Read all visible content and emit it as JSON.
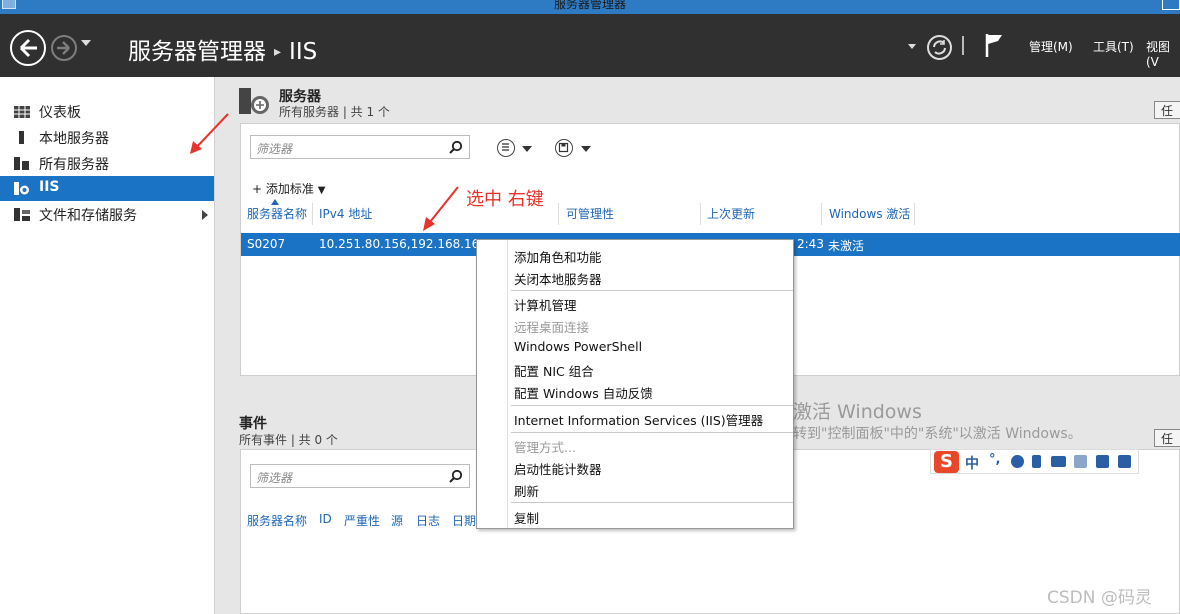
{
  "window": {
    "title": "服务器管理器"
  },
  "header": {
    "breadcrumb": [
      "服务器管理器",
      "IIS"
    ],
    "menus": [
      "管理(M)",
      "工具(T)",
      "视图(V"
    ]
  },
  "sidebar": {
    "items": [
      {
        "label": "仪表板",
        "icon": "dashboard-icon"
      },
      {
        "label": "本地服务器",
        "icon": "server-icon"
      },
      {
        "label": "所有服务器",
        "icon": "servers-icon"
      },
      {
        "label": "IIS",
        "icon": "iis-icon",
        "active": true
      },
      {
        "label": "文件和存储服务",
        "icon": "storage-icon",
        "has_submenu": true
      }
    ]
  },
  "servers_panel": {
    "title": "服务器",
    "subtitle": "所有服务器 | 共 1 个",
    "task_button": "任务",
    "filter_placeholder": "筛选器",
    "add_criteria": "添加标准",
    "columns": [
      "服务器名称",
      "IPv4 地址",
      "可管理性",
      "上次更新",
      "Windows 激活"
    ],
    "row": {
      "name": "S0207",
      "ipv4": "10.251.80.156,192.168.164.1",
      "last_update_tail": "2:43",
      "activation": "未激活"
    }
  },
  "events_panel": {
    "title": "事件",
    "subtitle": "所有事件 | 共 0 个",
    "task_button": "任务",
    "filter_placeholder": "筛选器",
    "columns": [
      "服务器名称",
      "ID",
      "严重性",
      "源",
      "日志",
      "日期"
    ]
  },
  "context_menu": {
    "groups": [
      [
        {
          "label": "添加角色和功能"
        },
        {
          "label": "关闭本地服务器"
        }
      ],
      [
        {
          "label": "计算机管理"
        },
        {
          "label": "远程桌面连接",
          "disabled": true
        },
        {
          "label": "Windows PowerShell"
        },
        {
          "label": "配置 NIC 组合"
        },
        {
          "label": "配置 Windows 自动反馈"
        }
      ],
      [
        {
          "label": "Internet Information Services (IIS)管理器"
        }
      ],
      [
        {
          "label": "管理方式...",
          "disabled": true
        },
        {
          "label": "启动性能计数器"
        },
        {
          "label": "刷新"
        }
      ],
      [
        {
          "label": "复制"
        }
      ]
    ]
  },
  "annotation": {
    "text": "选中 右键",
    "color": "#e8322a"
  },
  "activation_watermark": {
    "line1": "激活 Windows",
    "line2": "转到\"控制面板\"中的\"系统\"以激活 Windows。"
  },
  "ime_toolbar": {
    "logo": "S",
    "mode": "中",
    "punct": "°,"
  },
  "footer": {
    "csdn": "CSDN @码灵"
  },
  "colors": {
    "header_bg": "#303030",
    "accent": "#1a73c4",
    "annotation": "#e8322a"
  }
}
